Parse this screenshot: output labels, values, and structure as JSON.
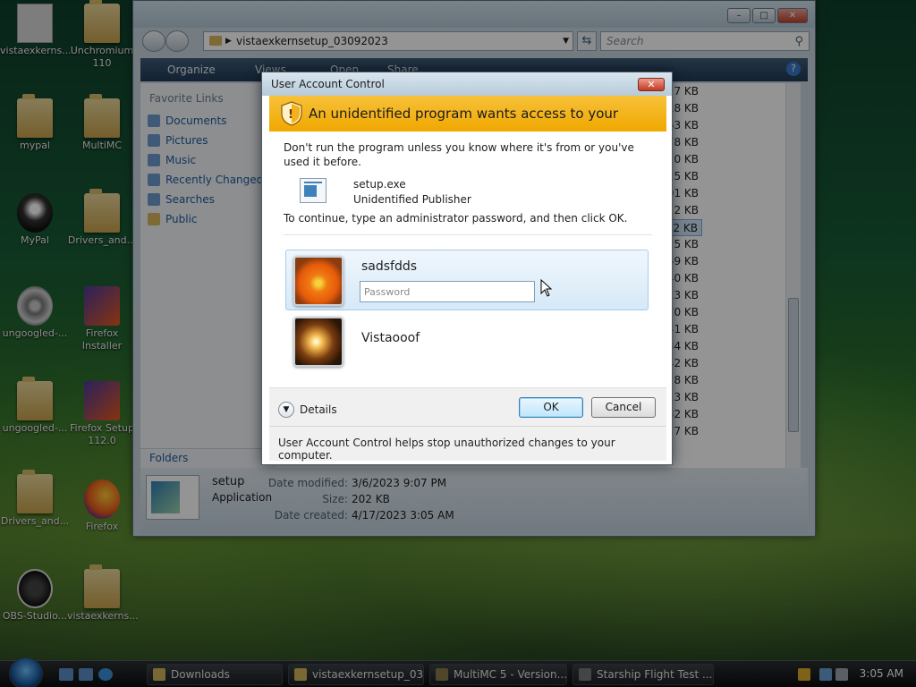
{
  "desktop": {
    "icons": [
      {
        "label": "vistaexkerns...",
        "x": 0,
        "y": 4
      },
      {
        "label": "Unchromium 110",
        "x": 75,
        "y": 4
      },
      {
        "label": "mypal"
      },
      {
        "label": "MultiMC"
      },
      {
        "label": "MyPal"
      },
      {
        "label": "Drivers_and..."
      },
      {
        "label": "ungoogled-..."
      },
      {
        "label": "Firefox Installer"
      },
      {
        "label": "ungoogled-..."
      },
      {
        "label": "Firefox Setup 112.0"
      },
      {
        "label": "Drivers_and..."
      },
      {
        "label": "Firefox"
      },
      {
        "label": "OBS-Studio..."
      },
      {
        "label": "vistaexkerns..."
      }
    ]
  },
  "explorer": {
    "address": "vistaexkernsetup_03092023",
    "search_placeholder": "Search",
    "toolbar": {
      "organize": "Organize",
      "views": "Views",
      "open": "Open",
      "share": "Share"
    },
    "nav": {
      "header": "Favorite Links",
      "links": [
        "Documents",
        "Pictures",
        "Music",
        "Recently Changed",
        "Searches",
        "Public"
      ],
      "folders": "Folders"
    },
    "sizes": [
      "7 KB",
      "18 KB",
      "663 KB",
      "878 KB",
      "320 KB",
      "125 KB",
      "101 KB",
      "2 KB",
      "202 KB",
      "5 KB",
      "669 KB",
      "540 KB",
      "313 KB",
      "870 KB",
      "231 KB",
      "634 KB",
      "142 KB",
      "8 KB",
      "313 KB",
      "232 KB",
      "077 KB"
    ],
    "selected_index": 8,
    "details": {
      "name": "setup",
      "type": "Application",
      "modified_label": "Date modified:",
      "modified": "3/6/2023 9:07 PM",
      "size_label": "Size:",
      "size": "202 KB",
      "created_label": "Date created:",
      "created": "4/17/2023 3:05 AM"
    }
  },
  "uac": {
    "title": "User Account Control",
    "banner": "An unidentified program wants access to your computer",
    "warning": "Don't run the program unless you know where it's from or you've used it before.",
    "program_name": "setup.exe",
    "publisher": "Unidentified Publisher",
    "instruction": "To continue, type an administrator password, and then click OK.",
    "users": [
      {
        "name": "sadsfdds",
        "password_placeholder": "Password"
      },
      {
        "name": "Vistaooof"
      }
    ],
    "details_label": "Details",
    "ok_label": "OK",
    "cancel_label": "Cancel",
    "footer_note": "User Account Control helps stop unauthorized changes to your computer.",
    "banner_color": "#f2b01a"
  },
  "taskbar": {
    "tasks": [
      "Downloads",
      "vistaexkernsetup_03...",
      "MultiMC 5 - Version...",
      "Starship Flight Test ..."
    ],
    "clock": "3:05 AM"
  }
}
